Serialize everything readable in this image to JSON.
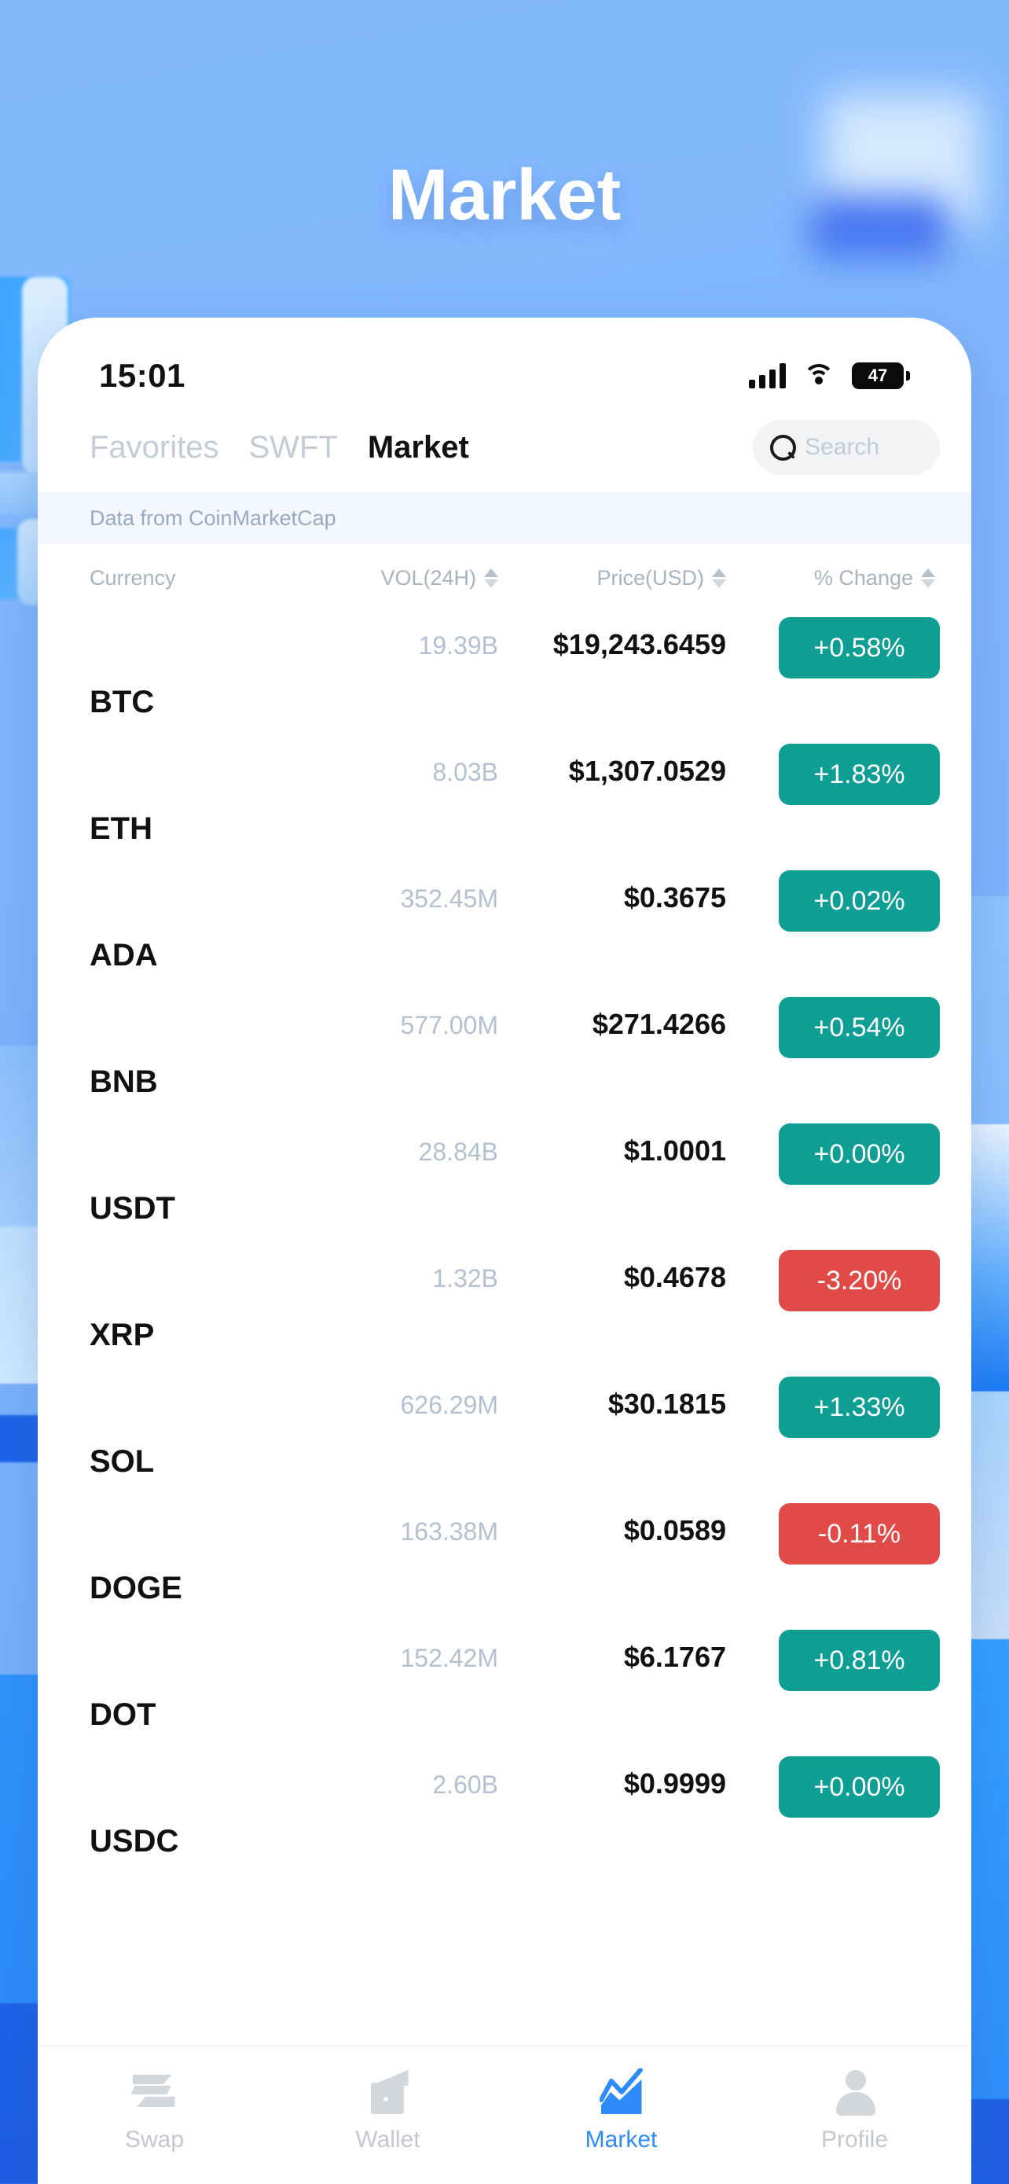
{
  "hero": {
    "title": "Market"
  },
  "statusbar": {
    "time": "15:01",
    "signal_icon": "cellular-signal-icon",
    "wifi_icon": "wifi-icon",
    "battery_level": "47"
  },
  "tabs": [
    {
      "label": "Favorites",
      "active": false
    },
    {
      "label": "SWFT",
      "active": false
    },
    {
      "label": "Market",
      "active": true
    }
  ],
  "search": {
    "placeholder": "Search",
    "icon": "search-icon"
  },
  "data_source": {
    "text": "Data from CoinMarketCap"
  },
  "columns": {
    "currency": "Currency",
    "volume": "VOL(24H)",
    "price": "Price(USD)",
    "change": "% Change"
  },
  "colors": {
    "up": "#0f9e94",
    "down": "#e04a47",
    "accent": "#2d8cfa",
    "muted": "#b4bfd0"
  },
  "rows": [
    {
      "currency": "BTC",
      "volume": "19.39B",
      "price": "$19,243.6459",
      "change": "+0.58%",
      "dir": "up"
    },
    {
      "currency": "ETH",
      "volume": "8.03B",
      "price": "$1,307.0529",
      "change": "+1.83%",
      "dir": "up"
    },
    {
      "currency": "ADA",
      "volume": "352.45M",
      "price": "$0.3675",
      "change": "+0.02%",
      "dir": "up"
    },
    {
      "currency": "BNB",
      "volume": "577.00M",
      "price": "$271.4266",
      "change": "+0.54%",
      "dir": "up"
    },
    {
      "currency": "USDT",
      "volume": "28.84B",
      "price": "$1.0001",
      "change": "+0.00%",
      "dir": "up"
    },
    {
      "currency": "XRP",
      "volume": "1.32B",
      "price": "$0.4678",
      "change": "-3.20%",
      "dir": "down"
    },
    {
      "currency": "SOL",
      "volume": "626.29M",
      "price": "$30.1815",
      "change": "+1.33%",
      "dir": "up"
    },
    {
      "currency": "DOGE",
      "volume": "163.38M",
      "price": "$0.0589",
      "change": "-0.11%",
      "dir": "down"
    },
    {
      "currency": "DOT",
      "volume": "152.42M",
      "price": "$6.1767",
      "change": "+0.81%",
      "dir": "up"
    },
    {
      "currency": "USDC",
      "volume": "2.60B",
      "price": "$0.9999",
      "change": "+0.00%",
      "dir": "up"
    }
  ],
  "bottom_nav": [
    {
      "label": "Swap",
      "icon": "swap-icon",
      "active": false
    },
    {
      "label": "Wallet",
      "icon": "wallet-icon",
      "active": false
    },
    {
      "label": "Market",
      "icon": "market-chart-icon",
      "active": true
    },
    {
      "label": "Profile",
      "icon": "profile-icon",
      "active": false
    }
  ]
}
